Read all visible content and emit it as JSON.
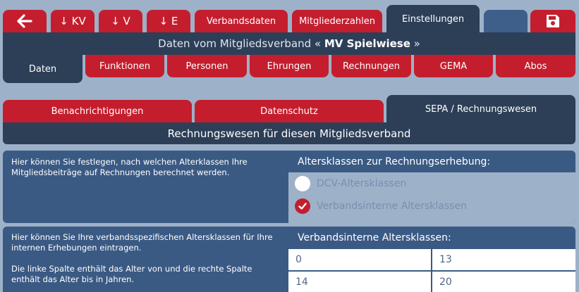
{
  "top_nav": {
    "back_icon": "arrow-left-icon",
    "kv_label": "↓ KV",
    "v_label": "↓ V",
    "e_label": "↓ E",
    "verbandsdaten_label": "Verbandsdaten",
    "mitgliederzahlen_label": "Mitgliederzahlen",
    "einstellungen_label": "Einstellungen",
    "save_icon": "floppy-disk-icon"
  },
  "header": {
    "prefix": "Daten vom Mitgliedsverband « ",
    "name": "MV Spielwiese",
    "suffix": " »"
  },
  "sub_nav": {
    "daten": "Daten",
    "funktionen": "Funktionen",
    "personen": "Personen",
    "ehrungen": "Ehrungen",
    "rechnungen": "Rechnungen",
    "gema": "GEMA",
    "abos": "Abos"
  },
  "settings_tabs": {
    "benachrichtigungen": "Benachrichtigungen",
    "datenschutz": "Datenschutz",
    "sepa": "SEPA / Rechnungswesen"
  },
  "section_title": "Rechnungswesen für diesen Mitgliedsverband",
  "altersklassen_panel": {
    "description": "Hier können Sie festlegen, nach welchen Alterklassen Ihre Mitgliedsbeiträge auf Rechnungen berechnet werden.",
    "heading": "Altersklassen zur Rechnungserhebung:",
    "option_dcv": "DCV-Altersklassen",
    "option_verband": "Verbandsinterne Altersklassen",
    "selected": "Verbandsinterne Altersklassen"
  },
  "verband_panel": {
    "description_1": "Hier können Sie Ihre verbandsspezifischen Altersklassen für Ihre internen Erhebungen eintragen.",
    "description_2": "Die linke Spalte enthält das Alter von und die rechte Spalte enthält das Alter bis in Jahren.",
    "heading": "Verbandsinterne Altersklassen:",
    "rows": [
      {
        "von": "0",
        "bis": "13"
      },
      {
        "von": "14",
        "bis": "20"
      }
    ]
  },
  "colors": {
    "red": "#c41e2e",
    "dark": "#2d3f57",
    "panel": "#3a5a84",
    "background": "#9db1c9"
  }
}
